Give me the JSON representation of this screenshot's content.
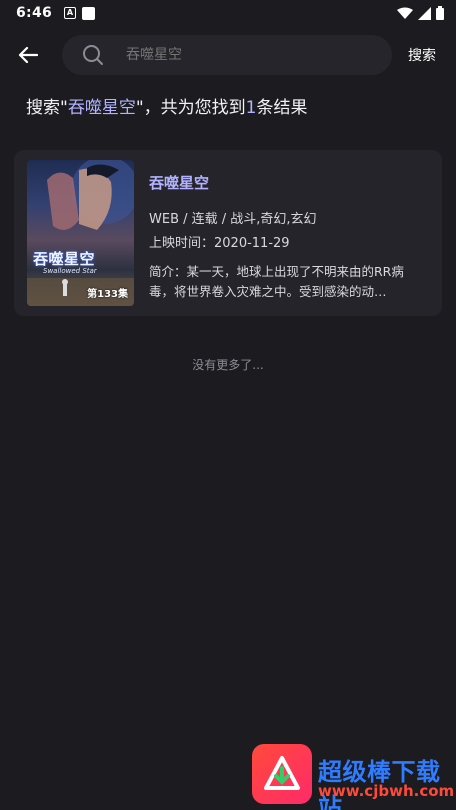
{
  "status_bar": {
    "time": "6:46",
    "notification_icon": "a-icon"
  },
  "header": {
    "back_icon": "arrow-left-icon",
    "search_placeholder": "吞噬星空",
    "search_button": "搜索"
  },
  "summary": {
    "prefix": "搜索\"",
    "keyword": "吞噬星空",
    "middle": "\"，共为您找到",
    "count": "1",
    "suffix": "条结果"
  },
  "results": [
    {
      "title": "吞噬星空",
      "meta": "WEB / 连载 / 战斗,奇幻,玄幻",
      "release": "上映时间：2020-11-29",
      "description": "简介：某一天，地球上出现了不明来由的RR病毒，将世界卷入灾难之中。受到感染的动…",
      "poster_title": "吞噬星空",
      "poster_subtitle": "Swallowed Star",
      "poster_episode": "第133集"
    }
  ],
  "footer_text": "没有更多了...",
  "watermark": {
    "name": "超级棒下载站",
    "url": "www.cjbwh.com"
  },
  "colors": {
    "background": "#1b1b20",
    "card": "#24242a",
    "accent": "#b2b2ff"
  }
}
